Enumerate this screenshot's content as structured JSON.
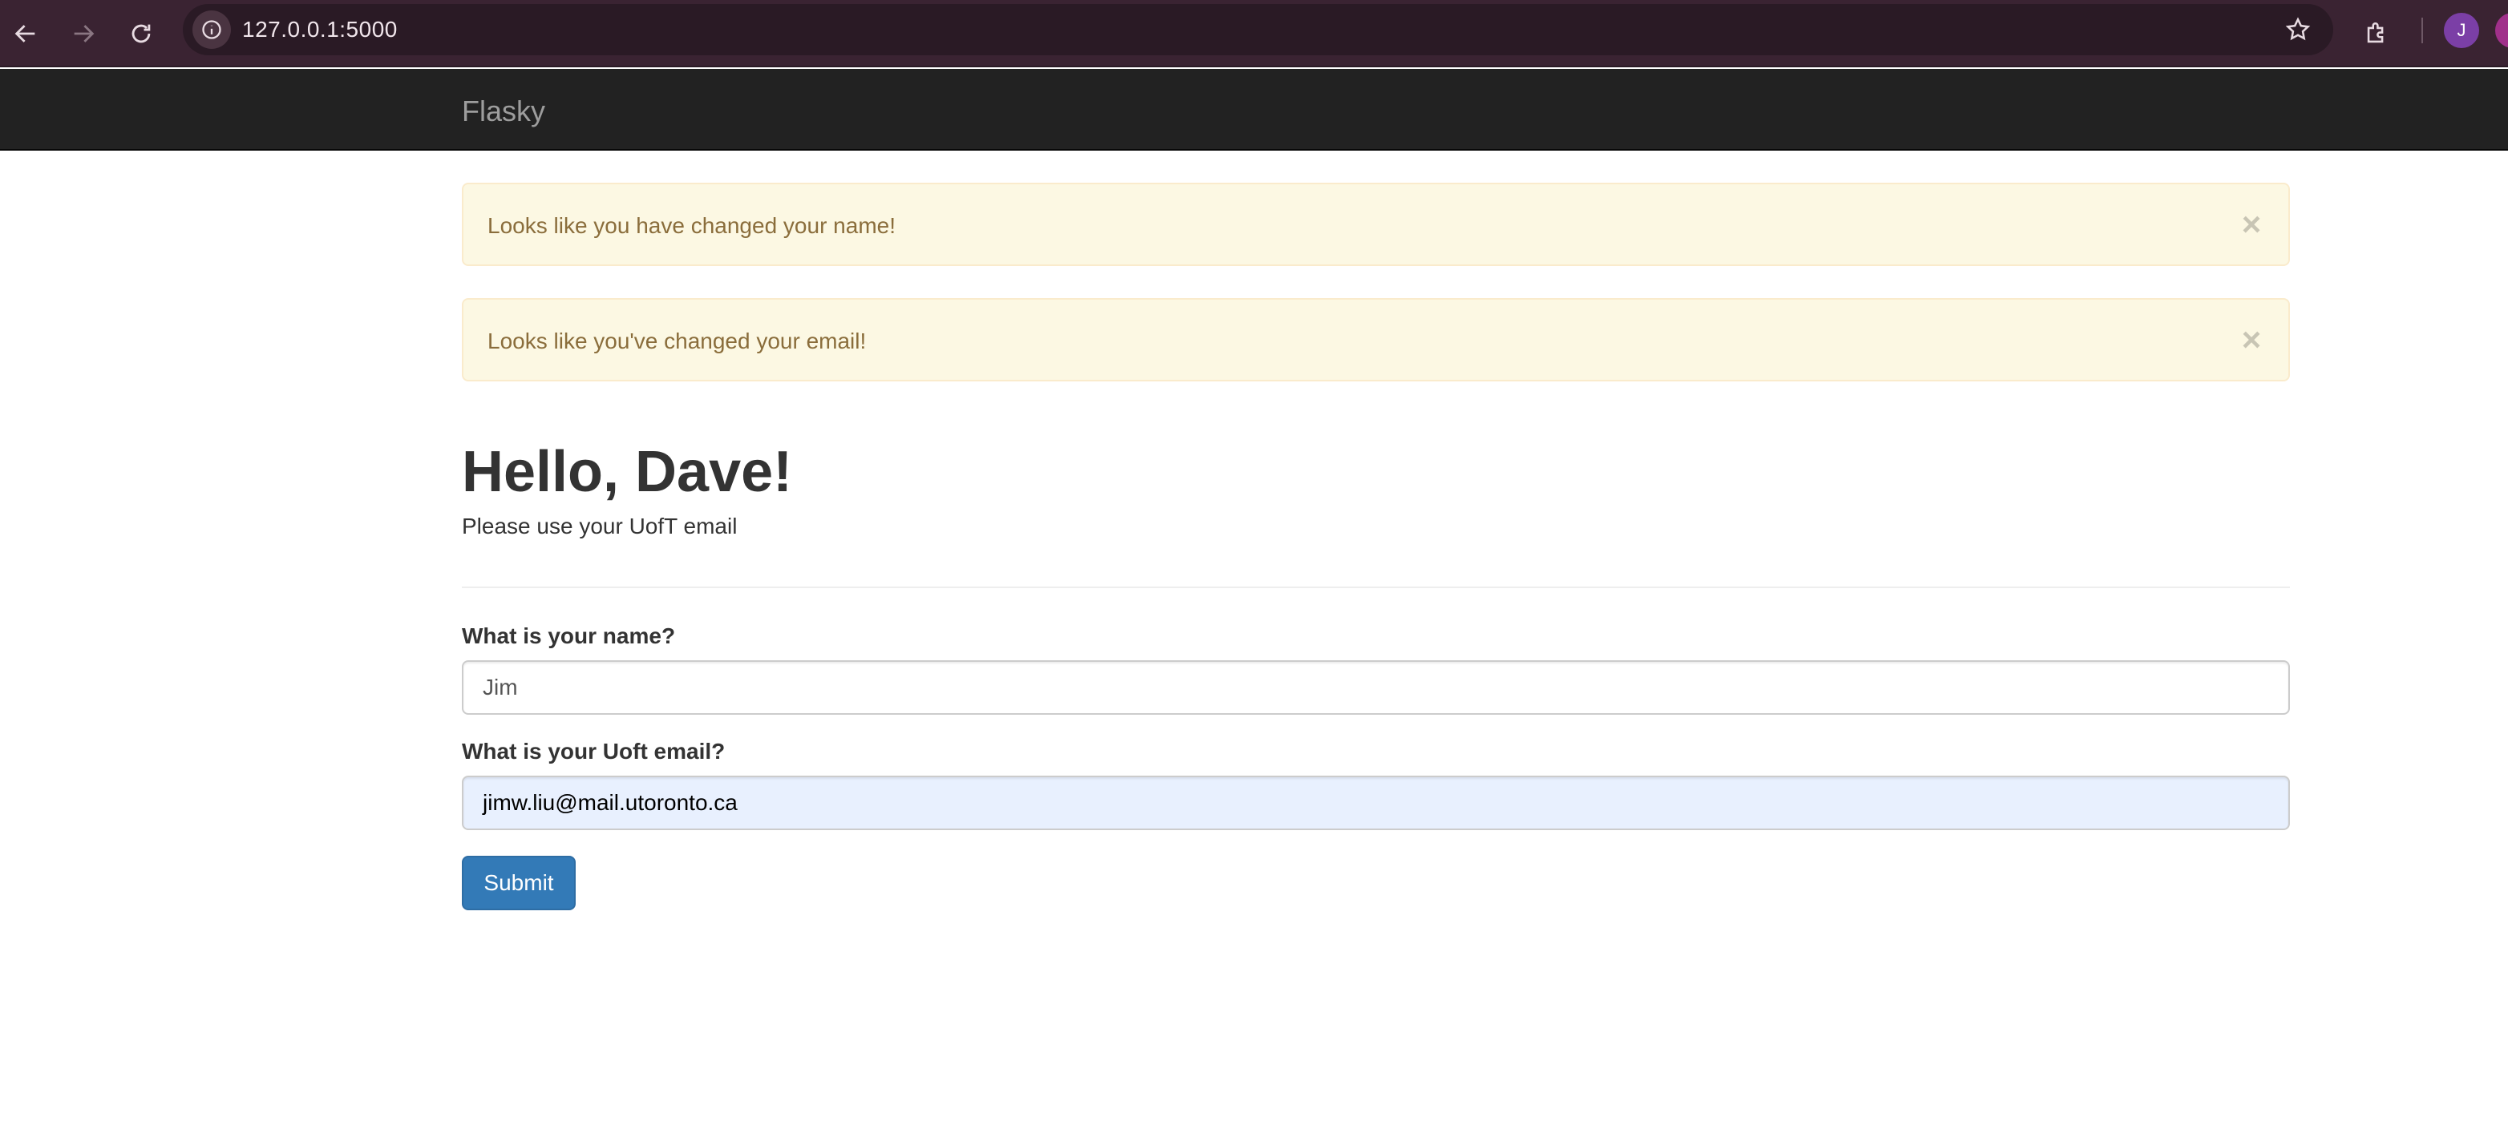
{
  "browser": {
    "url": "127.0.0.1:5000",
    "profile_initial": "J",
    "accent": "#3a2332"
  },
  "navbar": {
    "brand": "Flasky"
  },
  "alerts": [
    {
      "message": "Looks like you have changed your name!",
      "close": "×"
    },
    {
      "message": "Looks like you've changed your email!",
      "close": "×"
    }
  ],
  "header": {
    "title": "Hello, Dave!",
    "subtitle": "Please use your UofT email"
  },
  "form": {
    "name_label": "What is your name?",
    "name_value": "Jim",
    "email_label": "What is your Uoft email?",
    "email_value": "jimw.liu@mail.utoronto.ca",
    "submit_label": "Submit"
  },
  "colors": {
    "alert_bg": "#fcf8e3",
    "alert_text": "#8a6d3b",
    "button": "#337ab7",
    "navbar": "#222222"
  }
}
